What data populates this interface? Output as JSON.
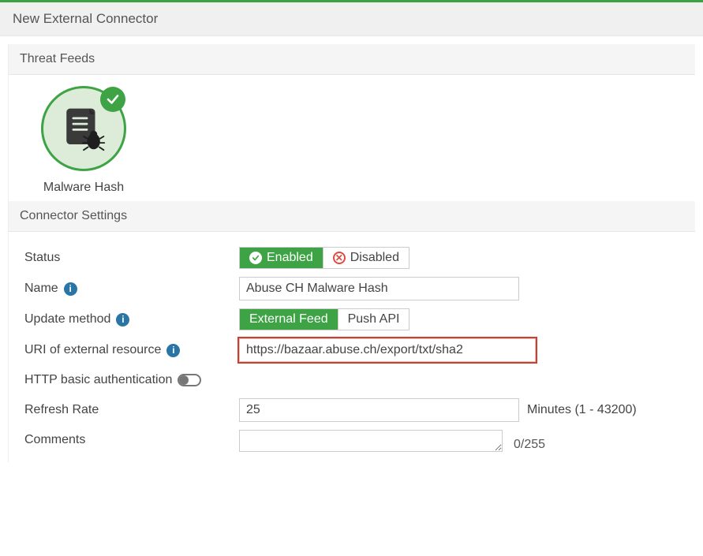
{
  "header": {
    "title": "New External Connector"
  },
  "threat_feeds": {
    "title": "Threat Feeds",
    "tile_label": "Malware Hash"
  },
  "connector_settings": {
    "title": "Connector Settings",
    "status": {
      "label": "Status",
      "enabled": "Enabled",
      "disabled": "Disabled"
    },
    "name": {
      "label": "Name",
      "value": "Abuse CH Malware Hash"
    },
    "update_method": {
      "label": "Update method",
      "external_feed": "External Feed",
      "push_api": "Push API"
    },
    "uri": {
      "label": "URI of external resource",
      "value": "https://bazaar.abuse.ch/export/txt/sha2"
    },
    "http_basic_auth": {
      "label": "HTTP basic authentication"
    },
    "refresh_rate": {
      "label": "Refresh Rate",
      "value": "25",
      "hint": "Minutes (1 - 43200)"
    },
    "comments": {
      "label": "Comments",
      "value": "",
      "counter": "0/255"
    }
  }
}
